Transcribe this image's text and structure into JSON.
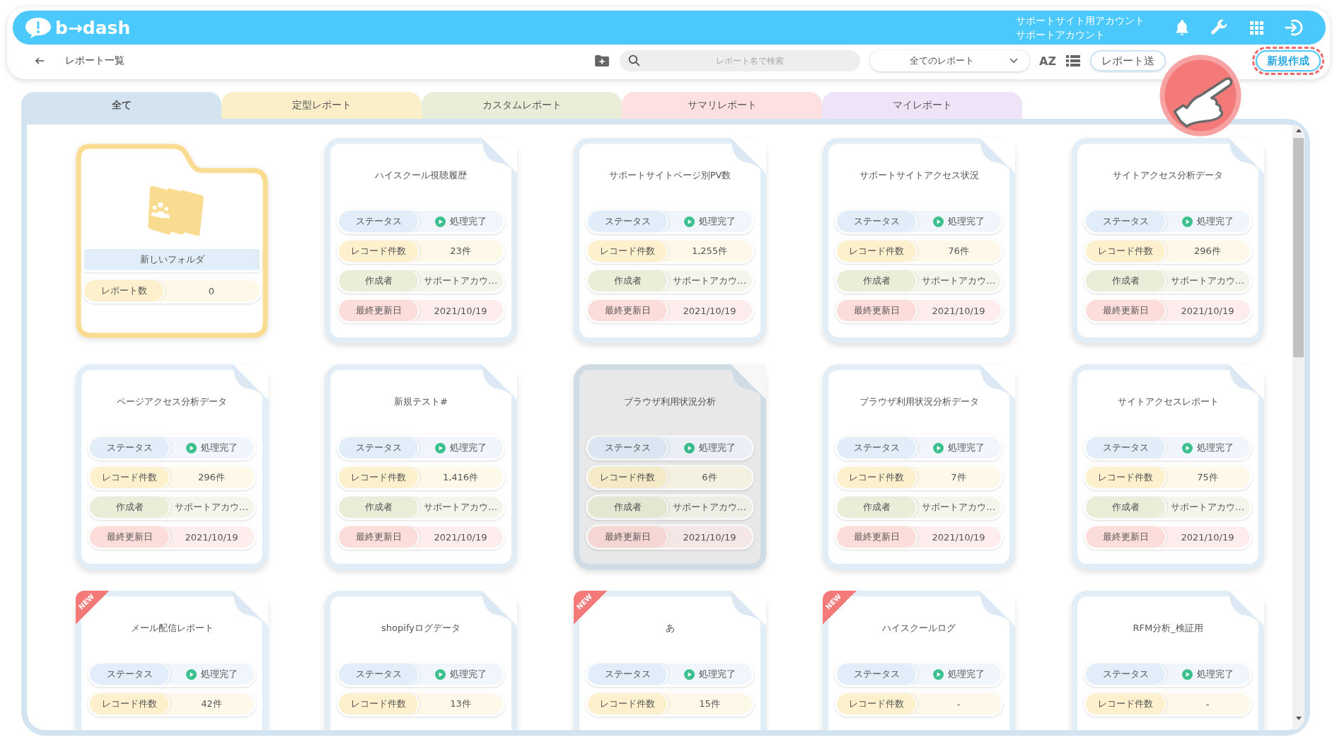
{
  "header": {
    "logo": "b→dash",
    "account_lines": [
      "サポートサイト用アカウント",
      "サポートアカウント"
    ]
  },
  "toolbar": {
    "title": "レポート一覧",
    "search": {
      "placeholder": "レポート名で検索"
    },
    "filter": "全てのレポート",
    "sort_label": "AZ",
    "buttons": [
      {
        "label": "レポート送",
        "kind": "secondary",
        "highlighted": false
      },
      {
        "label": "新規作成",
        "kind": "primary",
        "highlighted": true
      }
    ]
  },
  "tabs": [
    {
      "label": "全て",
      "selected": true,
      "color": "#d3e3f0"
    },
    {
      "label": "定型レポート",
      "selected": false,
      "color": "#fbefc9"
    },
    {
      "label": "カスタムレポート",
      "selected": false,
      "color": "#e8eed8"
    },
    {
      "label": "サマリレポート",
      "selected": false,
      "color": "#fde0df"
    },
    {
      "label": "マイレポート",
      "selected": false,
      "color": "#efe4f7"
    }
  ],
  "cards": [
    {
      "kind": "folder",
      "name": "新しいフォルダ",
      "fields": [
        {
          "kind": "records",
          "label": "レポート数",
          "value": "0"
        }
      ]
    },
    {
      "kind": "report",
      "title": "ハイスクール視聴履歴",
      "hovered": false,
      "fields": [
        {
          "kind": "status",
          "label": "ステータス",
          "value": "処理完了"
        },
        {
          "kind": "records",
          "label": "レコード件数",
          "value": "23件"
        },
        {
          "kind": "creator",
          "label": "作成者",
          "value": "サポートアカウ…"
        },
        {
          "kind": "updated",
          "label": "最終更新日",
          "value": "2021/10/19"
        }
      ]
    },
    {
      "kind": "report",
      "title": "サポートサイトページ別PV数",
      "hovered": false,
      "fields": [
        {
          "kind": "status",
          "label": "ステータス",
          "value": "処理完了"
        },
        {
          "kind": "records",
          "label": "レコード件数",
          "value": "1,255件"
        },
        {
          "kind": "creator",
          "label": "作成者",
          "value": "サポートアカウ…"
        },
        {
          "kind": "updated",
          "label": "最終更新日",
          "value": "2021/10/19"
        }
      ]
    },
    {
      "kind": "report",
      "title": "サポートサイトアクセス状況",
      "hovered": false,
      "fields": [
        {
          "kind": "status",
          "label": "ステータス",
          "value": "処理完了"
        },
        {
          "kind": "records",
          "label": "レコード件数",
          "value": "76件"
        },
        {
          "kind": "creator",
          "label": "作成者",
          "value": "サポートアカウ…"
        },
        {
          "kind": "updated",
          "label": "最終更新日",
          "value": "2021/10/19"
        }
      ]
    },
    {
      "kind": "report",
      "title": "サイトアクセス分析データ",
      "hovered": false,
      "fields": [
        {
          "kind": "status",
          "label": "ステータス",
          "value": "処理完了"
        },
        {
          "kind": "records",
          "label": "レコード件数",
          "value": "296件"
        },
        {
          "kind": "creator",
          "label": "作成者",
          "value": "サポートアカウ…"
        },
        {
          "kind": "updated",
          "label": "最終更新日",
          "value": "2021/10/19"
        }
      ]
    },
    {
      "kind": "report",
      "title": "ページアクセス分析データ",
      "hovered": false,
      "fields": [
        {
          "kind": "status",
          "label": "ステータス",
          "value": "処理完了"
        },
        {
          "kind": "records",
          "label": "レコード件数",
          "value": "296件"
        },
        {
          "kind": "creator",
          "label": "作成者",
          "value": "サポートアカウ…"
        },
        {
          "kind": "updated",
          "label": "最終更新日",
          "value": "2021/10/19"
        }
      ]
    },
    {
      "kind": "report",
      "title": "新規テスト#",
      "hovered": false,
      "fields": [
        {
          "kind": "status",
          "label": "ステータス",
          "value": "処理完了"
        },
        {
          "kind": "records",
          "label": "レコード件数",
          "value": "1,416件"
        },
        {
          "kind": "creator",
          "label": "作成者",
          "value": "サポートアカウ…"
        },
        {
          "kind": "updated",
          "label": "最終更新日",
          "value": "2021/10/19"
        }
      ]
    },
    {
      "kind": "report",
      "title": "ブラウザ利用状況分析",
      "hovered": true,
      "fields": [
        {
          "kind": "status",
          "label": "ステータス",
          "value": "処理完了"
        },
        {
          "kind": "records",
          "label": "レコード件数",
          "value": "6件"
        },
        {
          "kind": "creator",
          "label": "作成者",
          "value": "サポートアカウ…"
        },
        {
          "kind": "updated",
          "label": "最終更新日",
          "value": "2021/10/19"
        }
      ]
    },
    {
      "kind": "report",
      "title": "ブラウザ利用状況分析データ",
      "hovered": false,
      "fields": [
        {
          "kind": "status",
          "label": "ステータス",
          "value": "処理完了"
        },
        {
          "kind": "records",
          "label": "レコード件数",
          "value": "7件"
        },
        {
          "kind": "creator",
          "label": "作成者",
          "value": "サポートアカウ…"
        },
        {
          "kind": "updated",
          "label": "最終更新日",
          "value": "2021/10/19"
        }
      ]
    },
    {
      "kind": "report",
      "title": "サイトアクセスレポート",
      "hovered": false,
      "fields": [
        {
          "kind": "status",
          "label": "ステータス",
          "value": "処理完了"
        },
        {
          "kind": "records",
          "label": "レコード件数",
          "value": "75件"
        },
        {
          "kind": "creator",
          "label": "作成者",
          "value": "サポートアカウ…"
        },
        {
          "kind": "updated",
          "label": "最終更新日",
          "value": "2021/10/19"
        }
      ]
    },
    {
      "kind": "report",
      "title": "メール配信レポート",
      "badge": "NEW",
      "hovered": false,
      "fields": [
        {
          "kind": "status",
          "label": "ステータス",
          "value": "処理完了"
        },
        {
          "kind": "records",
          "label": "レコード件数",
          "value": "42件"
        }
      ]
    },
    {
      "kind": "report",
      "title": "shopifyログデータ",
      "hovered": false,
      "fields": [
        {
          "kind": "status",
          "label": "ステータス",
          "value": "処理完了"
        },
        {
          "kind": "records",
          "label": "レコード件数",
          "value": "13件"
        }
      ]
    },
    {
      "kind": "report",
      "title": "あ",
      "badge": "NEW",
      "hovered": false,
      "fields": [
        {
          "kind": "status",
          "label": "ステータス",
          "value": "処理完了"
        },
        {
          "kind": "records",
          "label": "レコード件数",
          "value": "15件"
        }
      ]
    },
    {
      "kind": "report",
      "title": "ハイスクールログ",
      "badge": "NEW",
      "hovered": false,
      "fields": [
        {
          "kind": "status",
          "label": "ステータス",
          "value": "処理完了"
        },
        {
          "kind": "records",
          "label": "レコード件数",
          "value": "-"
        }
      ]
    },
    {
      "kind": "report",
      "title": "RFM分析_検証用",
      "hovered": false,
      "fields": [
        {
          "kind": "status",
          "label": "ステータス",
          "value": "処理完了"
        },
        {
          "kind": "records",
          "label": "レコード件数",
          "value": "-"
        }
      ]
    }
  ]
}
